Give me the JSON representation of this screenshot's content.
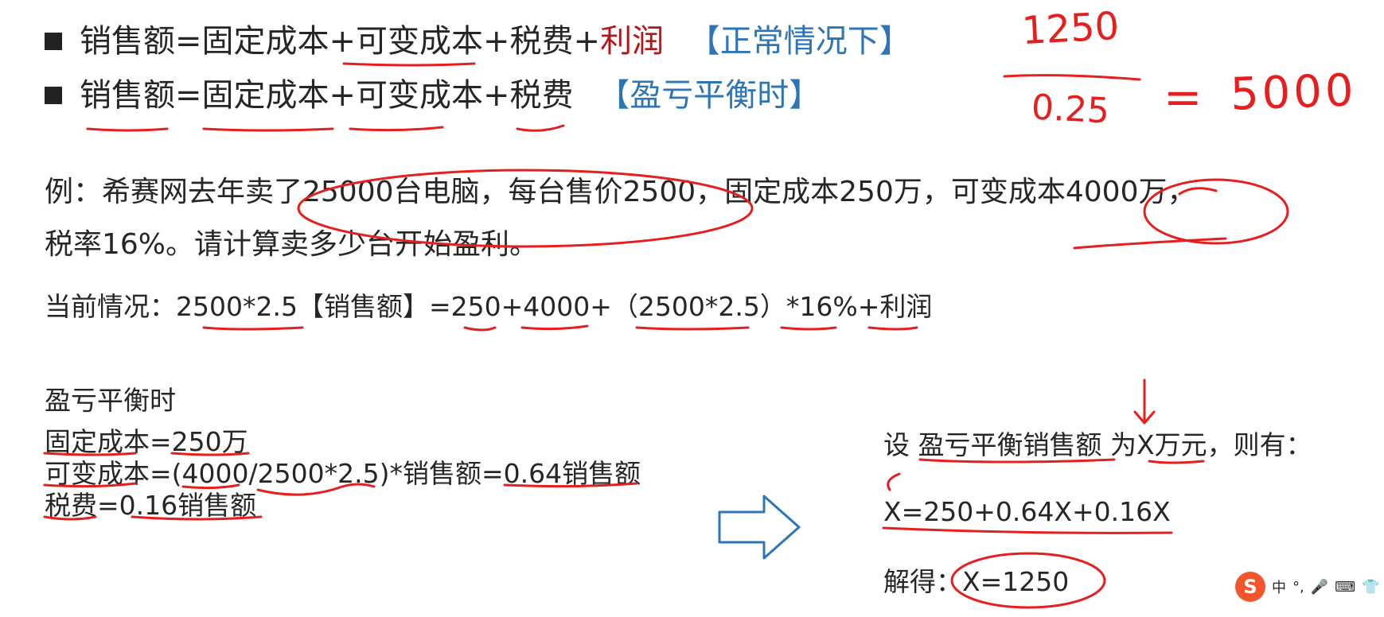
{
  "formulas": {
    "normal": {
      "prefix": "销售额=固定成本+可变成本+税费+",
      "profit": "利润",
      "tag": "【正常情况下】"
    },
    "breakeven": {
      "text": "销售额=固定成本+可变成本+税费",
      "tag": "【盈亏平衡时】"
    }
  },
  "example": {
    "line1": "例：希赛网去年卖了25000台电脑，每台售价2500，固定成本250万，可变成本4000万，",
    "line2": "税率16%。请计算卖多少台开始盈利。"
  },
  "current": {
    "text": "当前情况：2500*2.5【销售额】=250+4000+（2500*2.5）*16%+利润"
  },
  "breakeven_block": {
    "title": "盈亏平衡时",
    "fixed": "固定成本=250万",
    "variable": "可变成本=(4000/2500*2.5)*销售额=0.64销售额",
    "tax": "税费=0.16销售额"
  },
  "solution": {
    "assume": "设 盈亏平衡销售额 为X万元，则有：",
    "equation": "X=250+0.64X+0.16X",
    "result_label": "解得：",
    "result_value": "X=1250"
  },
  "handwriting": {
    "numerator": "1250",
    "denominator": "0.25",
    "equals": "=",
    "result": "5000"
  },
  "ime_toolbar": {
    "logo": "S",
    "lang": "中",
    "punct": "°,",
    "mic": "🎤",
    "keyboard": "⌨",
    "shirt": "👕"
  },
  "colors": {
    "ink": "#e61e1e",
    "profit": "#b2161b",
    "tag": "#2e75b6",
    "arrow": "#2e75b6"
  }
}
